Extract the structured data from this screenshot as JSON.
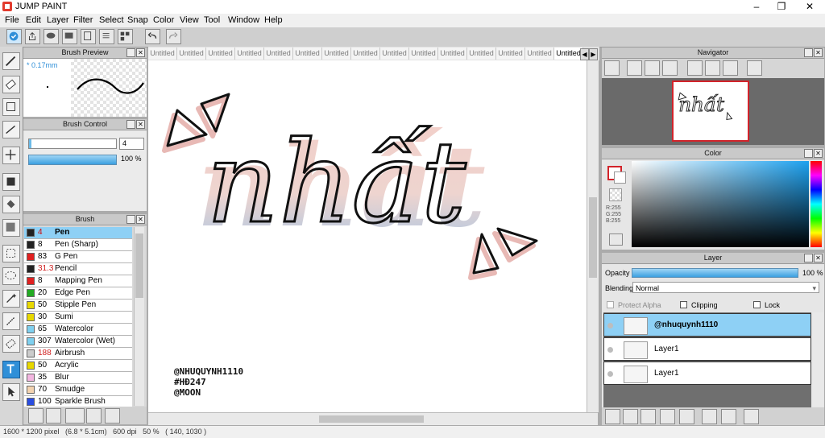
{
  "window": {
    "title": "JUMP PAINT",
    "min": "–",
    "max": "❐",
    "close": "✕"
  },
  "menu": [
    "File",
    "Edit",
    "Layer",
    "Filter",
    "Select",
    "Snap",
    "Color",
    "View",
    "Tool",
    "Window",
    "Help"
  ],
  "brush_preview": {
    "title": "Brush Preview",
    "size_label": "* 0.17mm"
  },
  "brush_control": {
    "title": "Brush Control",
    "size_value": "4",
    "opacity": "100 %"
  },
  "brush": {
    "title": "Brush",
    "items": [
      {
        "size": "4",
        "name": "Pen",
        "color": "#222222",
        "size_color": "#d00000"
      },
      {
        "size": "8",
        "name": "Pen (Sharp)",
        "color": "#222222",
        "size_color": "#000000"
      },
      {
        "size": "83",
        "name": "G Pen",
        "color": "#e02020",
        "size_color": "#000000"
      },
      {
        "size": "31.3",
        "name": "Pencil",
        "color": "#222222",
        "size_color": "#d02020"
      },
      {
        "size": "8",
        "name": "Mapping Pen",
        "color": "#e02020",
        "size_color": "#000000"
      },
      {
        "size": "20",
        "name": "Edge Pen",
        "color": "#22aa22",
        "size_color": "#000000"
      },
      {
        "size": "50",
        "name": "Stipple Pen",
        "color": "#e8d800",
        "size_color": "#000000"
      },
      {
        "size": "30",
        "name": "Sumi",
        "color": "#e8d800",
        "size_color": "#000000"
      },
      {
        "size": "65",
        "name": "Watercolor",
        "color": "#7fd0ef",
        "size_color": "#000000"
      },
      {
        "size": "307",
        "name": "Watercolor (Wet)",
        "color": "#7fd0ef",
        "size_color": "#000000"
      },
      {
        "size": "188",
        "name": "Airbrush",
        "color": "#cccccc",
        "size_color": "#d02020"
      },
      {
        "size": "50",
        "name": "Acrylic",
        "color": "#e8d800",
        "size_color": "#000000"
      },
      {
        "size": "35",
        "name": "Blur",
        "color": "#f3b6e0",
        "size_color": "#000000"
      },
      {
        "size": "70",
        "name": "Smudge",
        "color": "#f3d3b0",
        "size_color": "#000000"
      },
      {
        "size": "100",
        "name": "Sparkle Brush",
        "color": "#2a4de0",
        "size_color": "#000000"
      }
    ]
  },
  "tabs": [
    "Untitled",
    "Untitled",
    "Untitled",
    "Untitled",
    "Untitled",
    "Untitled",
    "Untitled",
    "Untitled",
    "Untitled",
    "Untitled",
    "Untitled",
    "Untitled",
    "Untitled",
    "Untitled",
    "Untitled"
  ],
  "canvas": {
    "lettering": "nhất",
    "credits": [
      "@NHUQUYNH1110",
      "#HĐ247",
      "@MOON"
    ]
  },
  "navigator": {
    "title": "Navigator"
  },
  "color": {
    "title": "Color",
    "r": "R:255",
    "g": "G:255",
    "b": "B:255"
  },
  "layer": {
    "title": "Layer",
    "opacity_label": "Opacity",
    "opacity": "100 %",
    "blending_label": "Blending",
    "blending": "Normal",
    "protect_alpha": "Protect Alpha",
    "clipping": "Clipping",
    "lock": "Lock",
    "items": [
      {
        "name": "@nhuquynh1110",
        "selected": true
      },
      {
        "name": "Layer1",
        "selected": false
      },
      {
        "name": "Layer1",
        "selected": false
      }
    ]
  },
  "status": {
    "text": "1600 * 1200 pixel   (6.8 * 5.1cm)   600 dpi   50 %   ( 140, 1030 )"
  }
}
